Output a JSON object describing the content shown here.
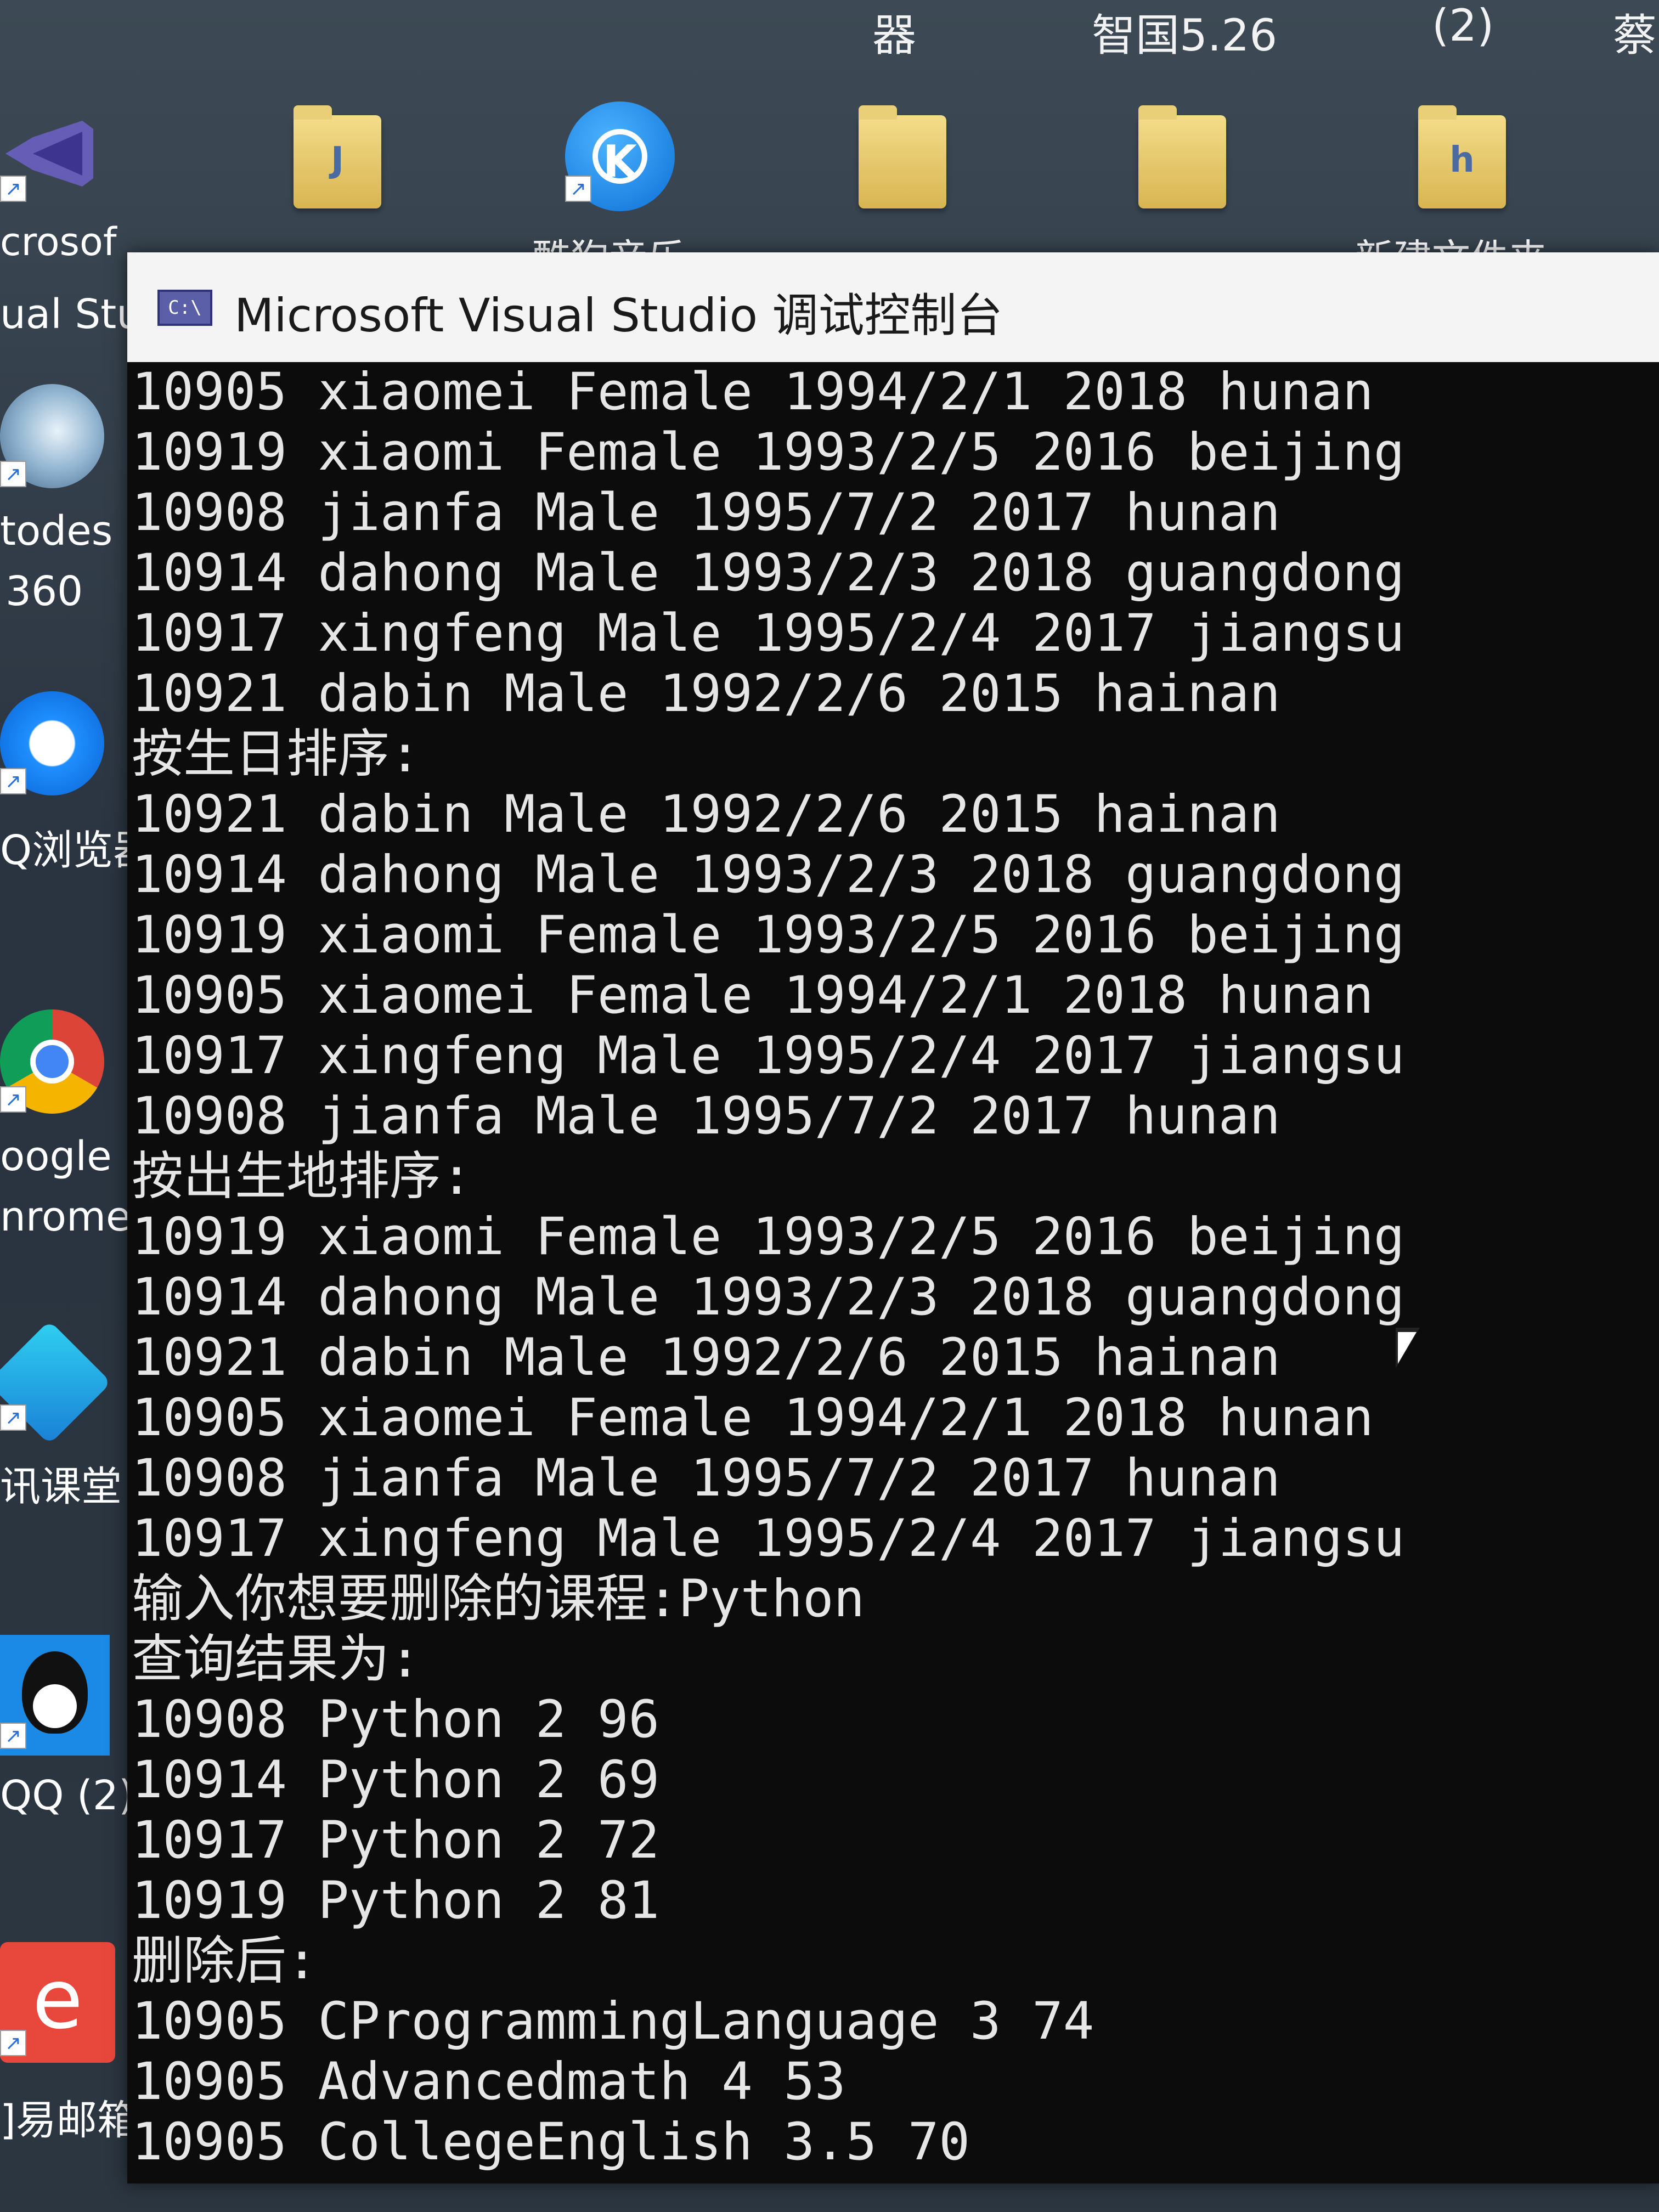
{
  "top_bar": {
    "labels": [
      "器",
      "智国5.26",
      "(2)",
      "蔡"
    ]
  },
  "desktop_icons_top": [
    {
      "label": "crosof",
      "icon": "visual-studio-icon"
    },
    {
      "label": "酷狗音乐",
      "icon": "kugou-music-icon"
    },
    {
      "label": "",
      "icon": "folder-icon"
    },
    {
      "label": "",
      "icon": "folder-icon"
    },
    {
      "label": "新建文件夹",
      "icon": "folder-icon"
    }
  ],
  "desktop_icons_left": [
    {
      "label": "ual Stu",
      "icon": "visual-studio-icon"
    },
    {
      "label": "todes",
      "icon": "autodesk-icon"
    },
    {
      "label": "360",
      "icon": ""
    },
    {
      "label": "Q浏览器",
      "icon": "qq-browser-icon"
    },
    {
      "label": "oogle",
      "icon": "google-chrome-icon"
    },
    {
      "label": "nrome",
      "icon": ""
    },
    {
      "label": "讯课堂",
      "icon": "tencent-classroom-icon"
    },
    {
      "label": "QQ (2)",
      "icon": "qq-icon"
    },
    {
      "label": "]易邮箱",
      "icon": "netease-mail-icon"
    }
  ],
  "window": {
    "title": "Microsoft Visual Studio 调试控制台",
    "icon_text": "C:\\"
  },
  "console_lines": [
    "10905 xiaomei Female 1994/2/1 2018 hunan",
    "10919 xiaomi Female 1993/2/5 2016 beijing",
    "10908 jianfa Male 1995/7/2 2017 hunan",
    "10914 dahong Male 1993/2/3 2018 guangdong",
    "10917 xingfeng Male 1995/2/4 2017 jiangsu",
    "10921 dabin Male 1992/2/6 2015 hainan",
    "按生日排序:",
    "10921 dabin Male 1992/2/6 2015 hainan",
    "10914 dahong Male 1993/2/3 2018 guangdong",
    "10919 xiaomi Female 1993/2/5 2016 beijing",
    "10905 xiaomei Female 1994/2/1 2018 hunan",
    "10917 xingfeng Male 1995/2/4 2017 jiangsu",
    "10908 jianfa Male 1995/7/2 2017 hunan",
    "按出生地排序:",
    "10919 xiaomi Female 1993/2/5 2016 beijing",
    "10914 dahong Male 1993/2/3 2018 guangdong",
    "10921 dabin Male 1992/2/6 2015 hainan",
    "10905 xiaomei Female 1994/2/1 2018 hunan",
    "10908 jianfa Male 1995/7/2 2017 hunan",
    "10917 xingfeng Male 1995/2/4 2017 jiangsu",
    "输入你想要删除的课程:Python",
    "查询结果为:",
    "10908 Python 2 96",
    "10914 Python 2 69",
    "10917 Python 2 72",
    "10919 Python 2 81",
    "删除后:",
    "10905 CProgrammingLanguage 3 74",
    "10905 Advancedmath 4 53",
    "10905 CollegeEnglish 3.5 70"
  ]
}
